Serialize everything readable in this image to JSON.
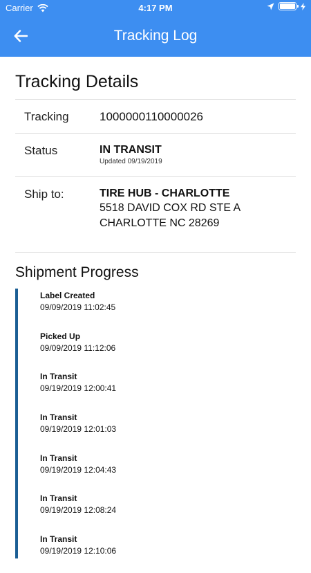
{
  "status_bar": {
    "carrier": "Carrier",
    "time": "4:17 PM",
    "icons": [
      "wifi-icon",
      "location-arrow-icon",
      "battery-icon",
      "charging-bolt-icon"
    ],
    "battery_level": 1.0
  },
  "nav": {
    "title": "Tracking Log",
    "back_icon": "arrow-left-icon"
  },
  "details": {
    "title": "Tracking Details",
    "tracking_label": "Tracking",
    "tracking_number": "1000000110000026",
    "status_label": "Status",
    "status_value": "IN TRANSIT",
    "status_updated": "Updated 09/19/2019",
    "ship_label": "Ship to:",
    "ship_name": "TIRE HUB - CHARLOTTE",
    "ship_address_1": "5518 DAVID COX RD STE A",
    "ship_address_2": "CHARLOTTE NC 28269"
  },
  "progress": {
    "title": "Shipment Progress",
    "events": [
      {
        "label": "Label Created",
        "time": "09/09/2019 11:02:45"
      },
      {
        "label": "Picked Up",
        "time": "09/09/2019 11:12:06"
      },
      {
        "label": "In Transit",
        "time": "09/19/2019 12:00:41"
      },
      {
        "label": "In Transit",
        "time": "09/19/2019 12:01:03"
      },
      {
        "label": "In Transit",
        "time": "09/19/2019 12:04:43"
      },
      {
        "label": "In Transit",
        "time": "09/19/2019 12:08:24"
      },
      {
        "label": "In Transit",
        "time": "09/19/2019 12:10:06"
      }
    ]
  },
  "colors": {
    "header": "#3d8ef1",
    "timeline": "#1b5e94",
    "divider": "#dcdcdc"
  }
}
